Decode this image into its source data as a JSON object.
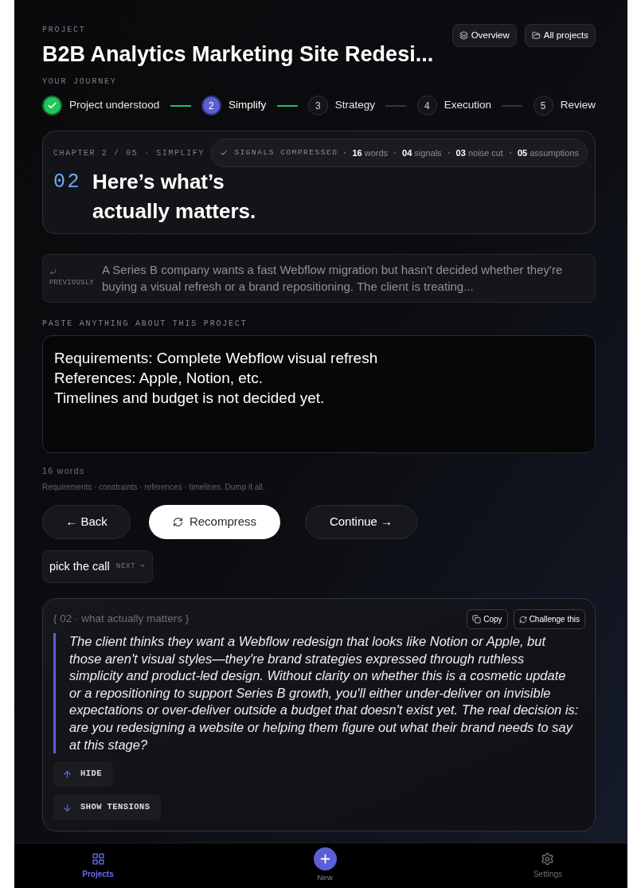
{
  "header": {
    "eyebrow": "PROJECT",
    "title": "B2B Analytics Marketing Site Redesi...",
    "actions": [
      {
        "label": "Overview"
      },
      {
        "label": "All projects"
      }
    ]
  },
  "journey": {
    "label": "YOUR JOURNEY",
    "steps": [
      {
        "label": "Project understood",
        "done": true,
        "selected": false
      },
      {
        "number": "2",
        "label": "Simplify",
        "done": false,
        "selected": true
      },
      {
        "number": "3",
        "label": "Strategy",
        "done": false,
        "selected": false
      },
      {
        "number": "4",
        "label": "Execution",
        "done": false,
        "selected": false
      },
      {
        "number": "5",
        "label": "Review",
        "done": false,
        "selected": false
      }
    ]
  },
  "chapter": {
    "eyebrow": "CHAPTER 2 / 05 · SIMPLIFY",
    "signals": {
      "label": "SIGNALS COMPRESSED",
      "stats": [
        "**16** words",
        "**04** signals",
        "**03** noise cut",
        "**05** assumptions"
      ]
    },
    "number": "02",
    "heading": "Here’s what’s actually matters."
  },
  "previously": {
    "label": "PREVIOUSLY",
    "text": "A Series B company wants a fast Webflow migration but hasn't decided whether they're buying a visual refresh or a brand repositioning. The client is treating..."
  },
  "input": {
    "label": "PASTE ANYTHING ABOUT THIS PROJECT",
    "value": "Requirements: Complete Webflow visual refresh\nReferences: Apple, Notion, etc.\nTimelines and budget is not decided yet.",
    "word_count": "16 words",
    "hint": "Requirements · constraints · references · timelines. Dump it all."
  },
  "actions": [
    {
      "label": "← Back",
      "kind": "secondary"
    },
    {
      "label": "Recompress",
      "kind": "primary"
    },
    {
      "label": "Continue →",
      "kind": "secondary"
    }
  ],
  "next": {
    "label": "pick the call",
    "tag": "NEXT ↪"
  },
  "insight": {
    "title": "{ 02 · what actually matters }",
    "buttons": [
      {
        "label": "Copy"
      },
      {
        "label": "Challenge this"
      }
    ],
    "text": "The client thinks they want a Webflow redesign that looks like Notion or Apple, but those aren't visual styles—they're brand strategies expressed through ruthless simplicity and product-led design. Without clarity on whether this is a cosmetic update or a repositioning to support Series B growth, you'll either under-deliver on invisible expectations or over-deliver outside a budget that doesn't exist yet. The real decision is: are you redesigning a website or helping them figure out what their brand needs to say at this stage?",
    "toggles": [
      {
        "label": "HIDE",
        "expanded": true
      },
      {
        "label": "SHOW TENSIONS",
        "expanded": false
      }
    ]
  },
  "nav": [
    {
      "label": "Projects",
      "kind": "tab",
      "selected": true
    },
    {
      "label": "New",
      "kind": "action",
      "selected": false
    },
    {
      "label": "Settings",
      "kind": "tab",
      "selected": false
    }
  ]
}
